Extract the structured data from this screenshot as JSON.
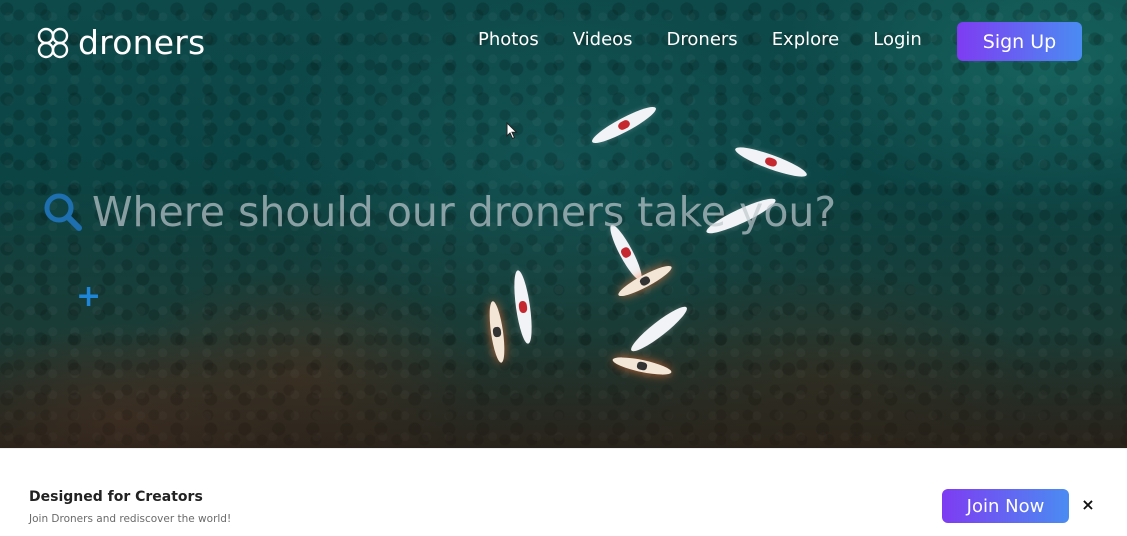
{
  "brand": {
    "name": "droners",
    "logo_icon": "quad-rotor-logo-icon"
  },
  "nav": {
    "items": [
      {
        "label": "Photos"
      },
      {
        "label": "Videos"
      },
      {
        "label": "Droners"
      },
      {
        "label": "Explore"
      },
      {
        "label": "Login"
      }
    ],
    "signup_label": "Sign Up"
  },
  "search": {
    "placeholder": "Where should our droners take you?",
    "icon": "search-icon"
  },
  "add": {
    "icon": "plus-icon"
  },
  "banner": {
    "title": "Designed for Creators",
    "subtitle": "Join Droners and rediscover the world!",
    "join_label": "Join Now",
    "close_label": "×"
  },
  "colors": {
    "accent_start": "#7e3cf2",
    "accent_end": "#4a8cf2",
    "search_icon": "#1e6fb0",
    "plus_icon": "#1e86d8"
  }
}
